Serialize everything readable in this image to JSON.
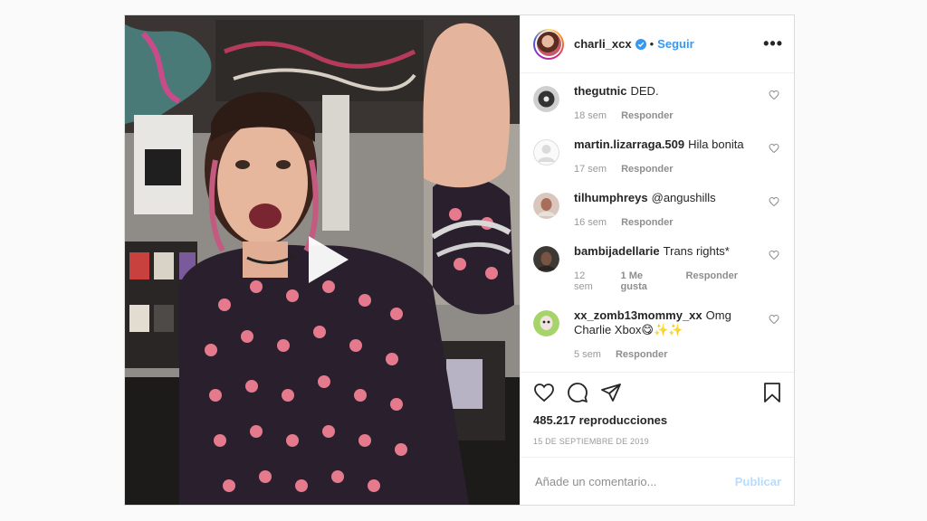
{
  "header": {
    "username": "charli_xcx",
    "separator": "•",
    "follow_label": "Seguir",
    "more_label": "•••"
  },
  "colors": {
    "link": "#3897f0",
    "verified": "#3897f0",
    "muted": "#999999",
    "publish_disabled": "#b9dcfb"
  },
  "comments": [
    {
      "user": "thegutnic",
      "text": "DED.",
      "time": "18 sem",
      "reply": "Responder",
      "avatar": "record-avatar"
    },
    {
      "user": "martin.lizarraga.509",
      "text": "Hila bonita",
      "time": "17 sem",
      "reply": "Responder",
      "avatar": "default-avatar"
    },
    {
      "user": "tilhumphreys",
      "text": "@angushills",
      "time": "16 sem",
      "reply": "Responder",
      "avatar": "photo-avatar"
    },
    {
      "user": "bambijadellarie",
      "text": "Trans rights*",
      "time": "12 sem",
      "likes": "1 Me gusta",
      "reply": "Responder",
      "avatar": "photo-avatar"
    },
    {
      "user": "xx_zomb13mommy_xx",
      "text": "Omg Charlie Xbox😋✨✨",
      "time": "5 sem",
      "reply": "Responder",
      "avatar": "photo-avatar"
    }
  ],
  "actions": {
    "icons": [
      "heart-icon",
      "comment-icon",
      "share-icon",
      "bookmark-icon"
    ],
    "views": "485.217 reproducciones",
    "date": "15 de septiembre de 2019"
  },
  "add_comment": {
    "placeholder": "Añade un comentario...",
    "publish_label": "Publicar"
  },
  "media": {
    "type": "video",
    "play_icon": "play-icon"
  }
}
